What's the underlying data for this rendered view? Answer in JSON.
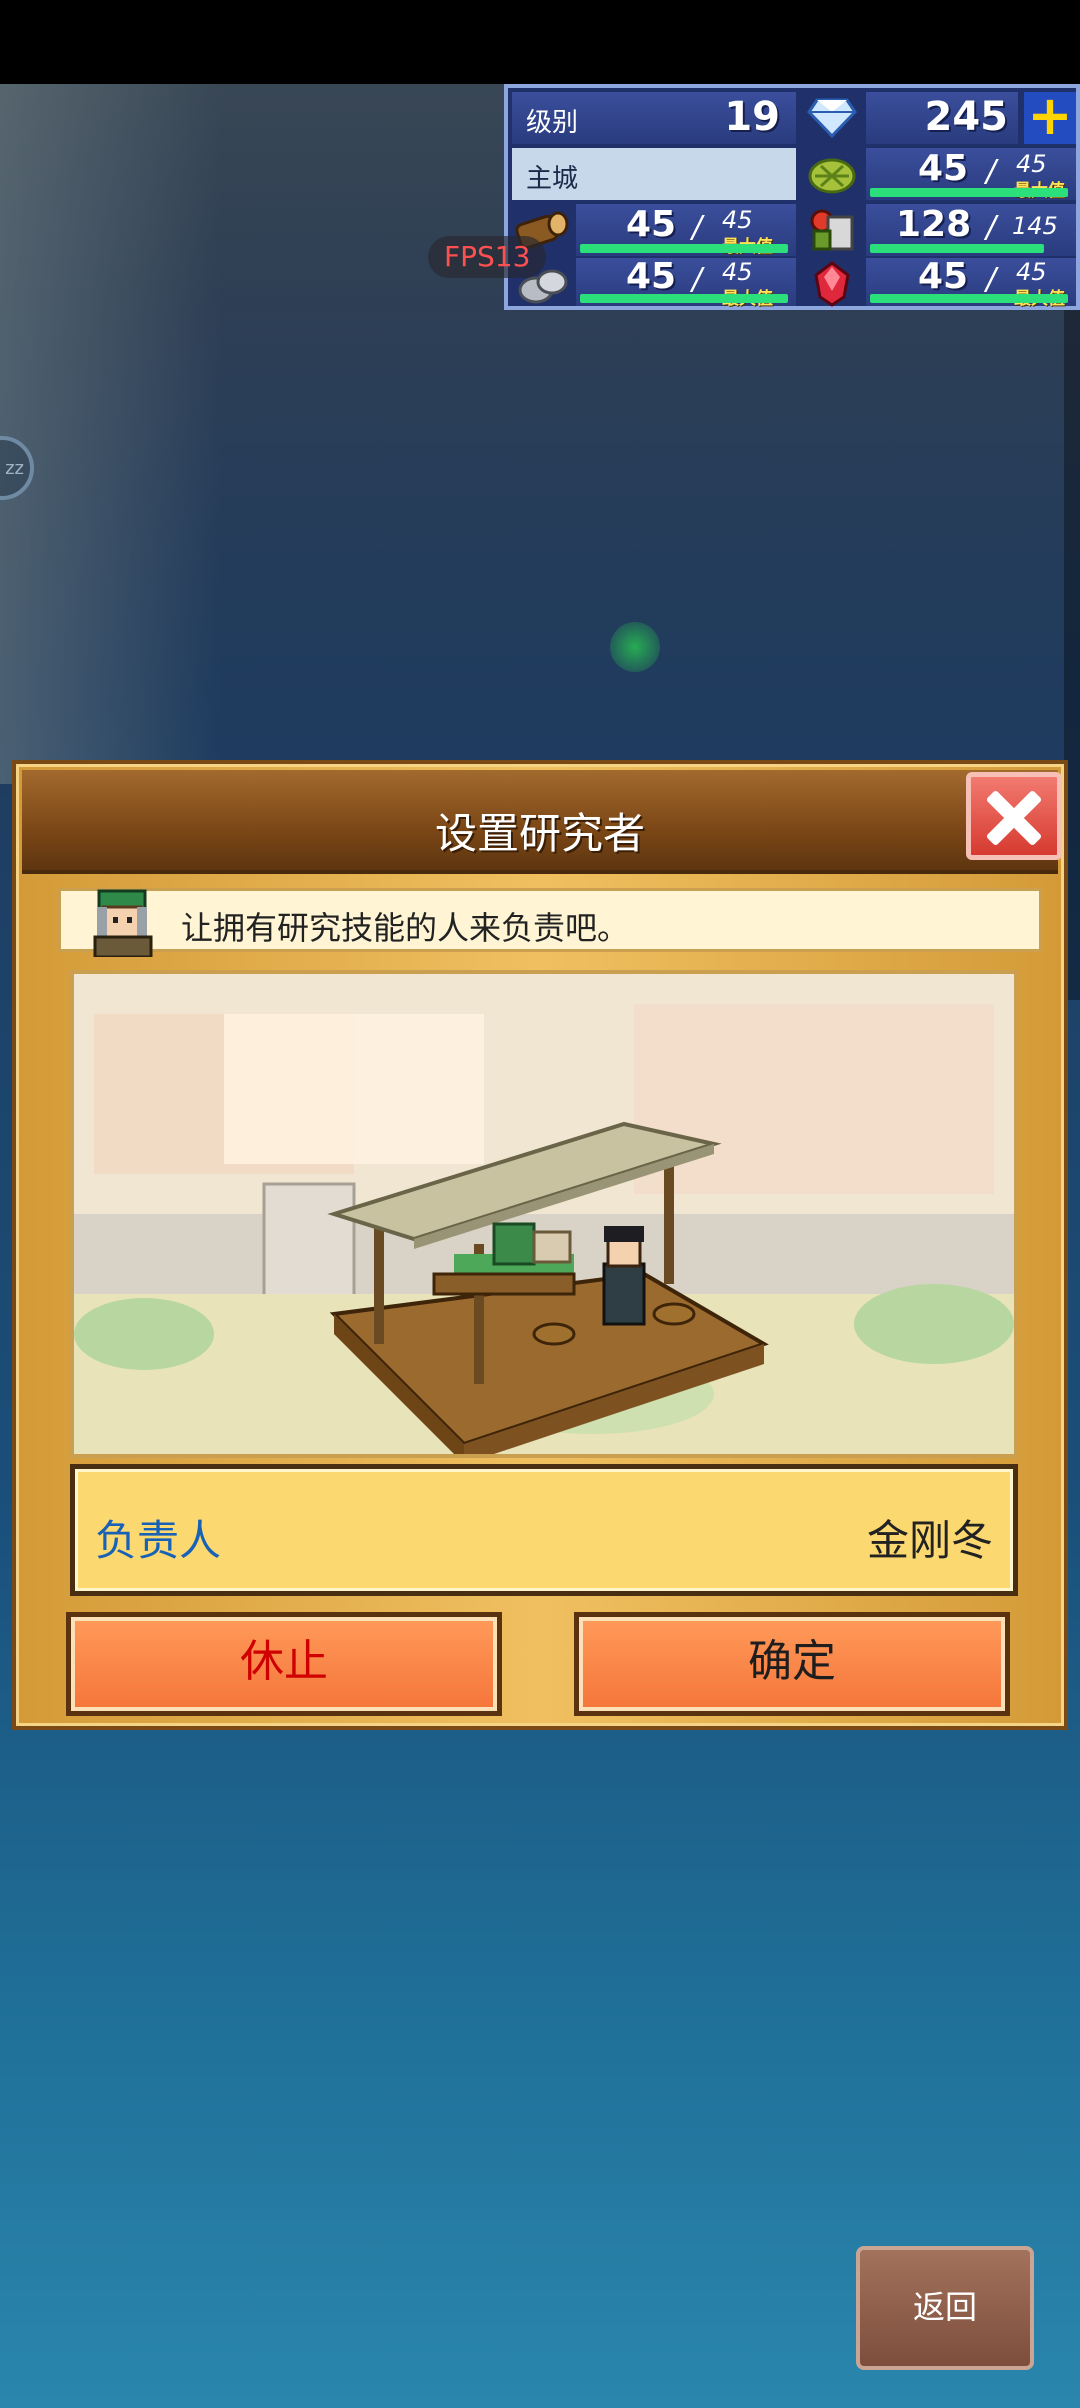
{
  "stats": {
    "level_label": "级别",
    "level_value": "19",
    "gems_value": "245",
    "city_label": "主城",
    "max_label": "最大值",
    "rows": [
      {
        "name": "crops",
        "current": "45",
        "max": "45",
        "fill": 1.0
      },
      {
        "name": "wood",
        "current": "45",
        "max": "45",
        "fill": 1.0
      },
      {
        "name": "food",
        "current": "128",
        "max": "145",
        "fill": 0.88
      },
      {
        "name": "stone",
        "current": "45",
        "max": "45",
        "fill": 1.0
      },
      {
        "name": "ruby",
        "current": "45",
        "max": "45",
        "fill": 1.0
      }
    ],
    "slash": "/"
  },
  "overlay": {
    "fps": "FPS13",
    "sleep": "zz"
  },
  "dialog": {
    "title": "设置研究者",
    "hint": "让拥有研究技能的人来负责吧。",
    "leader_label": "负责人",
    "leader_name": "金刚冬",
    "stop_label": "休止",
    "confirm_label": "确定"
  },
  "footer": {
    "back_label": "返回"
  },
  "colors": {
    "accent_orange": "#f5753a",
    "leader_blue": "#1762b6",
    "stop_red": "#d00000",
    "bar_green": "#2be07a"
  }
}
